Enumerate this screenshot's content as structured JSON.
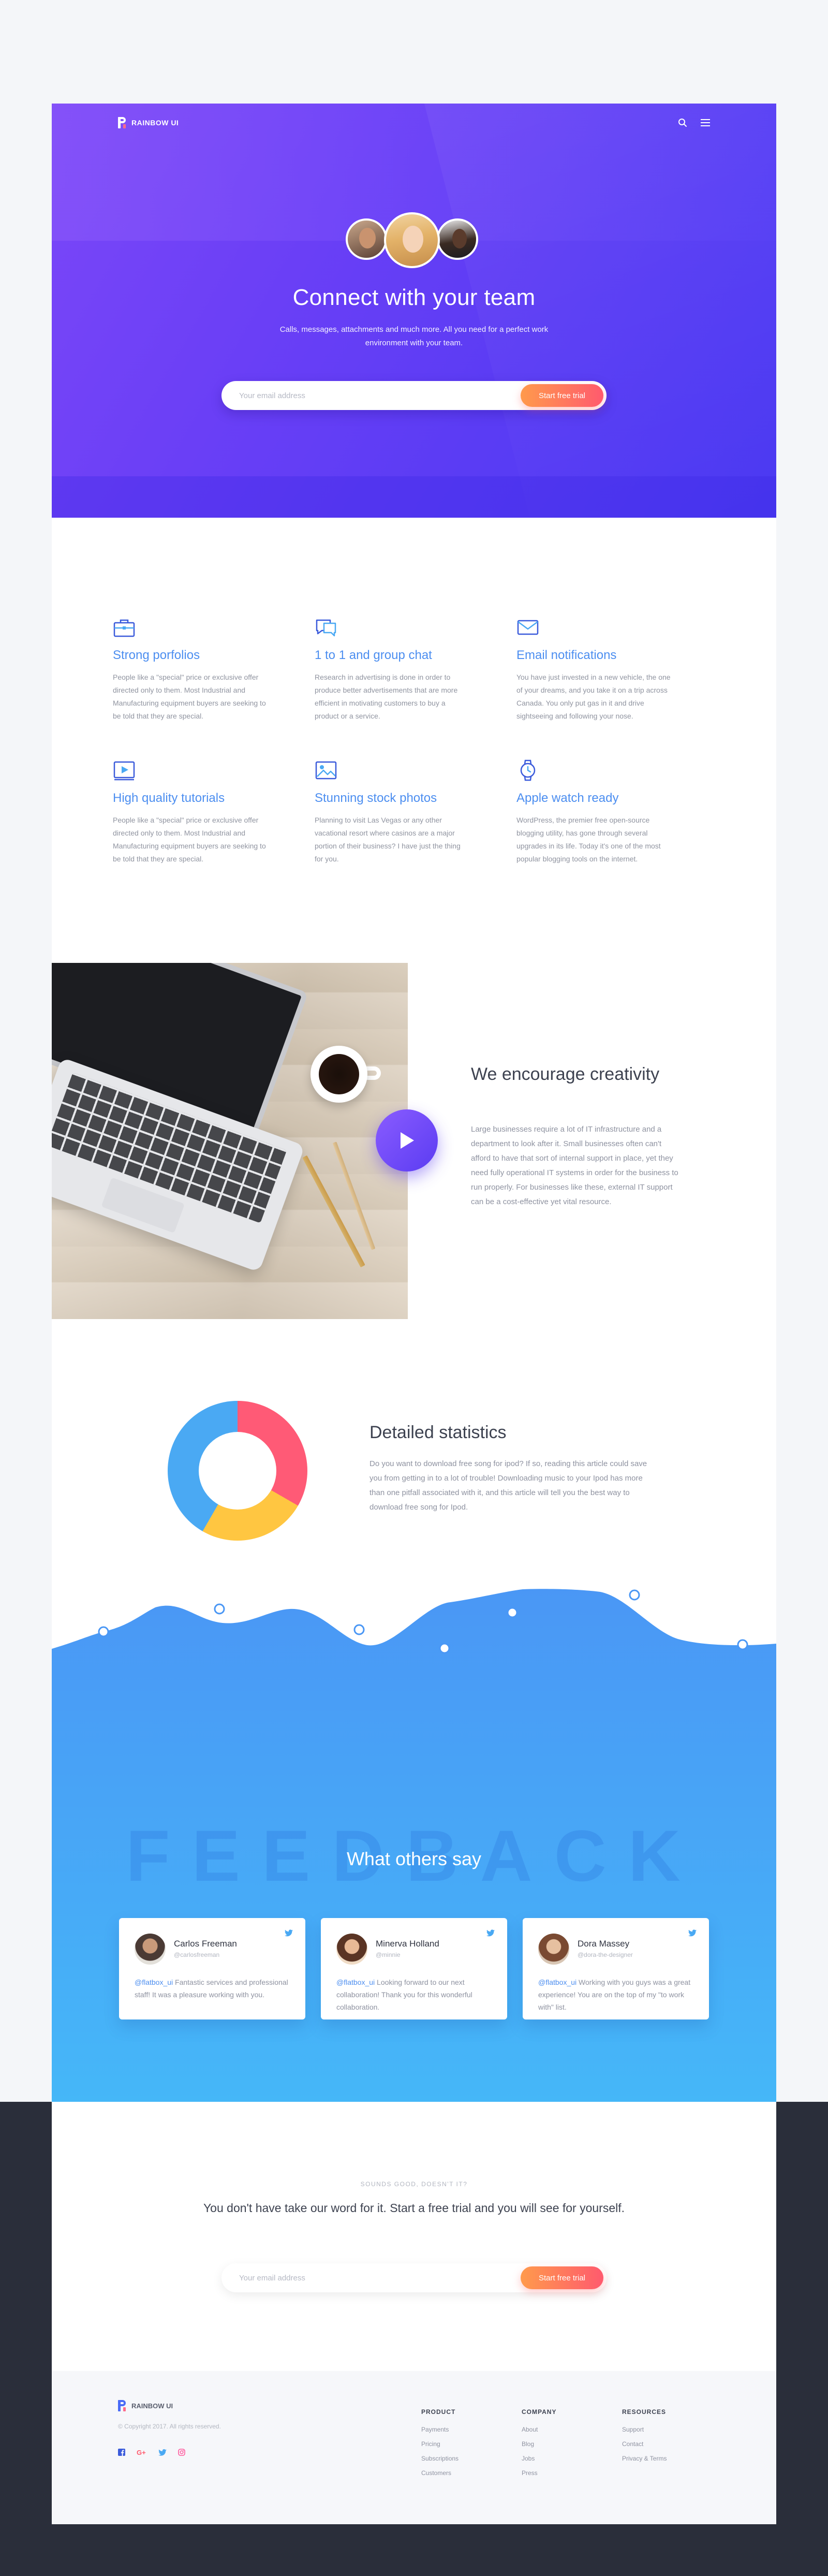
{
  "nav": {
    "brand": "RAINBOW UI"
  },
  "hero": {
    "title": "Connect with your team",
    "subtitle": "Calls, messages, attachments and much more. All you need for a perfect work environment with your team.",
    "email_placeholder": "Your email address",
    "cta_label": "Start free trial"
  },
  "features": [
    {
      "icon": "briefcase-icon",
      "title": "Strong porfolios",
      "text": "People like a \"special\" price or exclusive offer directed only to them. Most Industrial and Manufacturing equipment buyers are seeking to be told that they are special."
    },
    {
      "icon": "chat-icon",
      "title": "1 to 1 and group chat",
      "text": "Research in advertising is done in order to produce better advertisements that are more efficient in motivating customers to buy a product or a service."
    },
    {
      "icon": "mail-icon",
      "title": "Email notifications",
      "text": "You have just invested in a new vehicle, the one of your dreams, and you take it on a trip across Canada. You only put gas in it and drive sightseeing and following your nose."
    },
    {
      "icon": "video-icon",
      "title": "High quality tutorials",
      "text": "People like a \"special\" price or exclusive offer directed only to them. Most Industrial and Manufacturing equipment buyers are seeking to be told that they are special."
    },
    {
      "icon": "image-icon",
      "title": "Stunning stock photos",
      "text": "Planning to visit Las Vegas or any other vacational resort where casinos are a major portion of their business? I have just the thing for you."
    },
    {
      "icon": "watch-icon",
      "title": "Apple watch ready",
      "text": "WordPress, the premier free open-source blogging utility, has gone through several upgrades in its life. Today it's one of the most popular blogging tools on the internet."
    }
  ],
  "creativity": {
    "title": "We encourage creativity",
    "text": "Large businesses require a lot of IT infrastructure and a department to look after it. Small businesses often can't afford to have that sort of internal support in place, yet they need fully operational IT systems in order for the business to run properly. For businesses like these, external IT support can be a cost-effective yet vital resource."
  },
  "stats": {
    "title": "Detailed statistics",
    "text": "Do you want to download free song for ipod? If so, reading this article could save you from getting in to a lot of trouble! Downloading music to your Ipod has more than one pitfall associated with it, and this article will tell you the best way to download free song for Ipod.",
    "colors": {
      "red": "#ff5a76",
      "yellow": "#ffc641",
      "blue": "#4aa9f3"
    }
  },
  "feedback": {
    "watermark": "FEEDBACK",
    "title": "What others say",
    "cards": [
      {
        "name": "Carlos Freeman",
        "handle": "@carlosfreeman",
        "mention": "@flatbox_ui",
        "text": " Fantastic services and professional staff! It was a pleasure working with you."
      },
      {
        "name": "Minerva Holland",
        "handle": "@minnie",
        "mention": "@flatbox_ui",
        "text": " Looking forward to our next collaboration! Thank you for this wonderful collaboration."
      },
      {
        "name": "Dora Massey",
        "handle": "@dora-the-designer",
        "mention": "@flatbox_ui",
        "text": " Working with you guys was a great experience! You are on the top of my \"to work with\" list."
      }
    ]
  },
  "cta": {
    "kicker": "SOUNDS GOOD, DOESN'T IT?",
    "title": "You don't have take our word for it. Start a free trial and you will see for yourself.",
    "email_placeholder": "Your email address",
    "button_label": "Start free trial"
  },
  "footer": {
    "brand": "RAINBOW UI",
    "copyright": "© Copyright 2017. All rights reserved.",
    "columns": [
      {
        "title": "PRODUCT",
        "links": [
          "Payments",
          "Pricing",
          "Subscriptions",
          "Customers"
        ]
      },
      {
        "title": "COMPANY",
        "links": [
          "About",
          "Blog",
          "Jobs",
          "Press"
        ]
      },
      {
        "title": "RESOURCES",
        "links": [
          "Support",
          "Contact",
          "Privacy & Terms"
        ]
      }
    ]
  }
}
